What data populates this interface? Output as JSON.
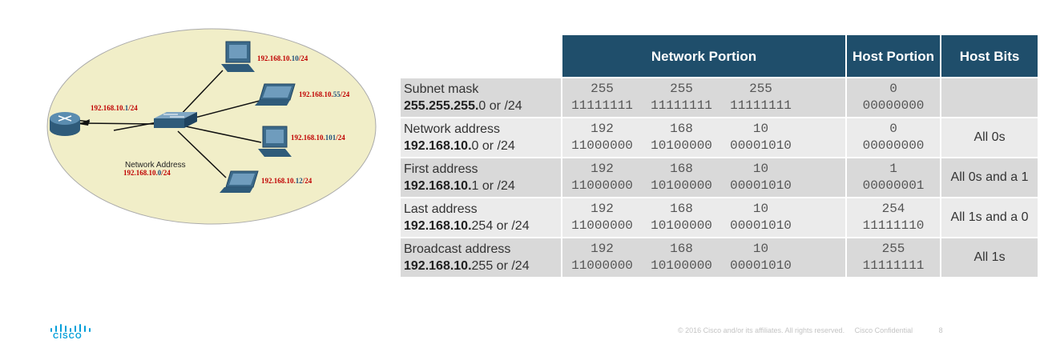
{
  "diagram": {
    "router_ip": {
      "net": "192.168.10.",
      "host": "1",
      "mask": "/24"
    },
    "hosts": [
      {
        "net": "192.168.10.",
        "host": "10",
        "mask": "/24",
        "device": "desktop-pc"
      },
      {
        "net": "192.168.10.",
        "host": "55",
        "mask": "/24",
        "device": "laptop"
      },
      {
        "net": "192.168.10.",
        "host": "101",
        "mask": "/24",
        "device": "desktop-pc"
      },
      {
        "net": "192.168.10.",
        "host": "12",
        "mask": "/24",
        "device": "laptop"
      }
    ],
    "network_address_label": "Network Address",
    "network_address": {
      "net": "192.168.10.",
      "host": "0",
      "mask": "/24"
    },
    "colors": {
      "ellipse": "#f1eec8",
      "network_part": "#c00000",
      "host_part": "#1f4e79",
      "device": "#3c6a8a"
    }
  },
  "table": {
    "headers": [
      "Network Portion",
      "Host Portion",
      "Host Bits"
    ],
    "rows": [
      {
        "name": "Subnet mask",
        "prefix": "255.255.255.",
        "suffix": "0 or /24",
        "octets": [
          "255",
          "255",
          "255"
        ],
        "octet_bits": [
          "11111111",
          "11111111",
          "11111111"
        ],
        "host_dec": "0",
        "host_bits": "00000000",
        "host_bits_label": ""
      },
      {
        "name": "Network address",
        "prefix": "192.168.10.",
        "suffix": "0 or /24",
        "octets": [
          "192",
          "168",
          "10"
        ],
        "octet_bits": [
          "11000000",
          "10100000",
          "00001010"
        ],
        "host_dec": "0",
        "host_bits": "00000000",
        "host_bits_label": "All 0s"
      },
      {
        "name": "First address",
        "prefix": "192.168.10.",
        "suffix": "1 or /24",
        "octets": [
          "192",
          "168",
          "10"
        ],
        "octet_bits": [
          "11000000",
          "10100000",
          "00001010"
        ],
        "host_dec": "1",
        "host_bits": "00000001",
        "host_bits_label": "All 0s and a 1"
      },
      {
        "name": "Last address",
        "prefix": "192.168.10.",
        "suffix": "254 or /24",
        "octets": [
          "192",
          "168",
          "10"
        ],
        "octet_bits": [
          "11000000",
          "10100000",
          "00001010"
        ],
        "host_dec": "254",
        "host_bits": "11111110",
        "host_bits_label": "All 1s and a 0"
      },
      {
        "name": "Broadcast address",
        "prefix": "192.168.10.",
        "suffix": "255 or /24",
        "octets": [
          "192",
          "168",
          "10"
        ],
        "octet_bits": [
          "11000000",
          "10100000",
          "00001010"
        ],
        "host_dec": "255",
        "host_bits": "11111111",
        "host_bits_label": "All 1s"
      }
    ],
    "colors": {
      "header": "#1f4e6b",
      "row_dark": "#d9d9d9",
      "row_light": "#ebebeb"
    }
  },
  "footer": {
    "copyright": "© 2016  Cisco and/or its affiliates. All rights reserved.",
    "confidential": "Cisco Confidential",
    "page_number": "8",
    "logo_text": "CISCO",
    "logo_color": "#049fd9"
  }
}
